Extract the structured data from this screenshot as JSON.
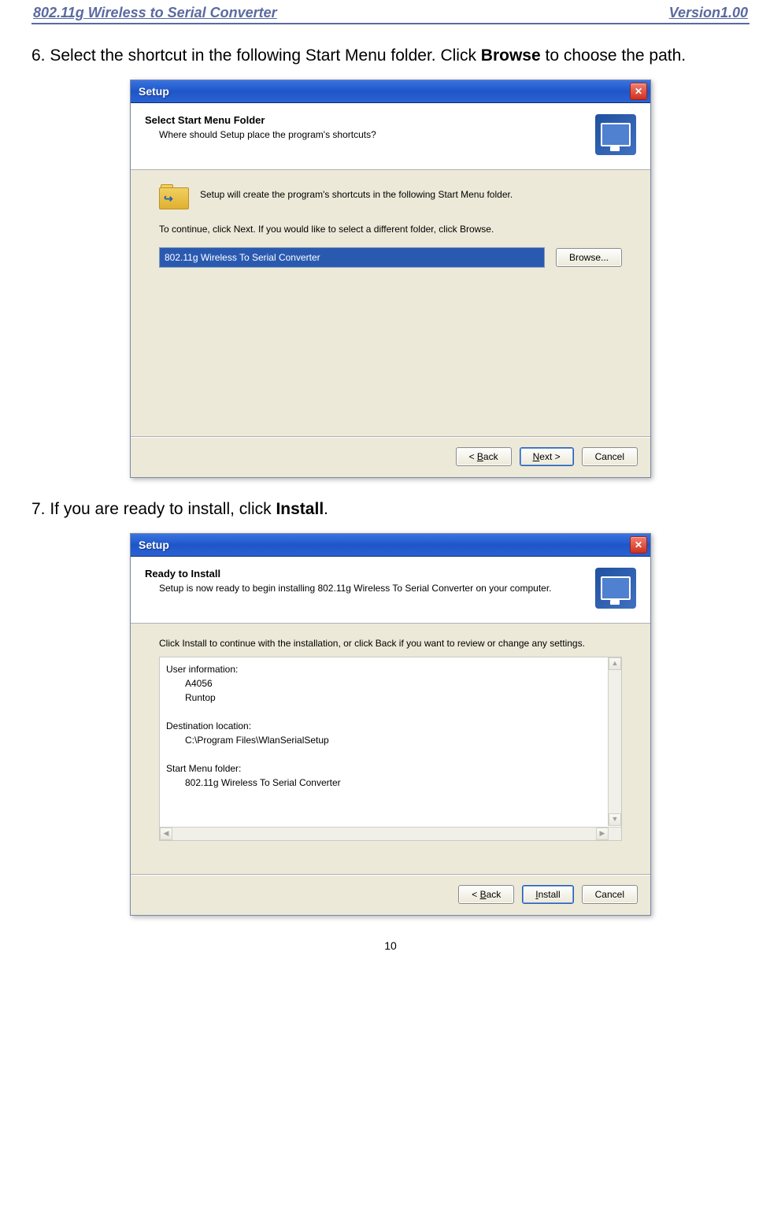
{
  "doc": {
    "header_left": "802.11g Wireless to Serial Converter",
    "header_right": "Version1.00",
    "step6": "6. Select the shortcut in the following Start Menu folder. Click ",
    "step6_bold": "Browse",
    "step6_after": " to choose the path.",
    "step7_prefix": "7.  If you are ready to install, click ",
    "step7_bold": "Install",
    "step7_after": ".",
    "page_num": "10"
  },
  "dialog1": {
    "title": "Setup",
    "head_title": "Select Start Menu Folder",
    "head_sub": "Where should Setup place the program's shortcuts?",
    "info": "Setup will create the program's shortcuts in the following Start Menu folder.",
    "continue_text": "To continue, click Next. If you would like to select a different folder, click Browse.",
    "path_value": "802.11g Wireless To Serial Converter",
    "browse_label": "Browse...",
    "back_label": "< Back",
    "back_u": "B",
    "next_label": "Next >",
    "next_u": "N",
    "cancel_label": "Cancel"
  },
  "dialog2": {
    "title": "Setup",
    "head_title": "Ready to Install",
    "head_sub": "Setup is now ready to begin installing 802.11g Wireless To Serial Converter on your computer.",
    "instruct": "Click Install to continue with the installation, or click Back if you want to review or change any settings.",
    "l_user_h": "User information:",
    "l_user_1": "A4056",
    "l_user_2": "Runtop",
    "l_dest_h": "Destination location:",
    "l_dest_1": "C:\\Program Files\\WlanSerialSetup",
    "l_sm_h": "Start Menu folder:",
    "l_sm_1": "802.11g Wireless To Serial Converter",
    "back_label": "< Back",
    "back_u": "B",
    "install_label": "Install",
    "install_u": "I",
    "cancel_label": "Cancel"
  }
}
